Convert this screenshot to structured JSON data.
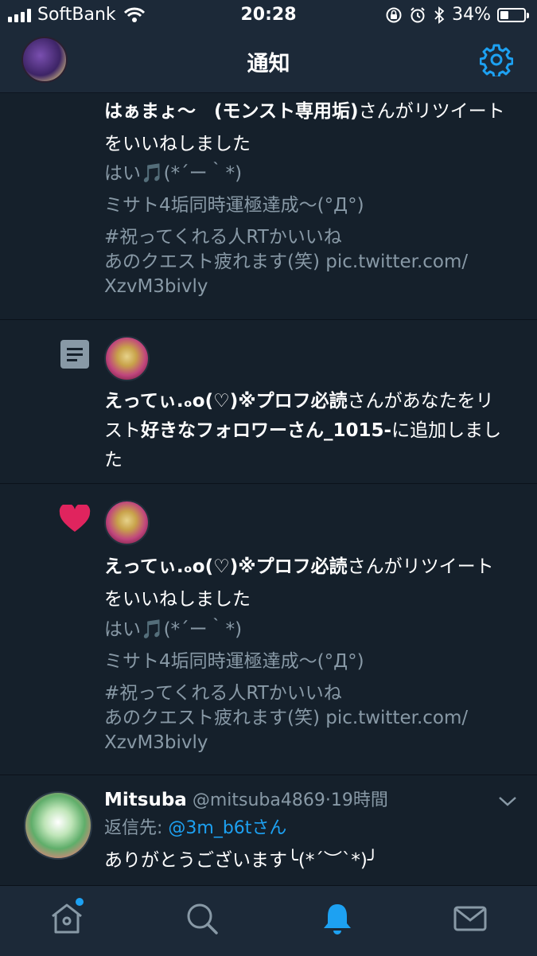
{
  "status_bar": {
    "carrier": "SoftBank",
    "time": "20:28",
    "battery": "34%",
    "battery_level": 0.34
  },
  "header": {
    "title": "通知"
  },
  "notifications": [
    {
      "type": "like",
      "user": "はぁまょ〜　(モンスト専用垢)",
      "action_line1": "さんがリツイート",
      "action_line2": "をいいねしました",
      "quote": [
        "はい🎵(*´ー｀*)",
        "ミサト4垢同時運極達成〜(°Д°)",
        "#祝ってくれる人RTかいいね",
        "あのクエスト疲れます(笑) pic.twitter.com/",
        "XzvM3bivly"
      ]
    },
    {
      "type": "list",
      "icon": "list-icon",
      "user": "えってぃ.ₒo(♡)※プロフ必読",
      "action_a": "さんがあなたをリ",
      "action_b": "スト",
      "list_name": "好きなフォロワーさん_1015-",
      "action_c": "に追加しまし",
      "action_d": "た"
    },
    {
      "type": "like",
      "icon": "heart-icon",
      "color": "#e0245e",
      "user": "えってぃ.ₒo(♡)※プロフ必読",
      "action_line1": "さんがリツイート",
      "action_line2": "をいいねしました",
      "quote": [
        "はい🎵(*´ー｀*)",
        "ミサト4垢同時運極達成〜(°Д°)",
        "#祝ってくれる人RTかいいね",
        "あのクエスト疲れます(笑) pic.twitter.com/",
        "XzvM3bivly"
      ]
    }
  ],
  "tweet": {
    "name": "Mitsuba",
    "handle": "@mitsuba4869",
    "separator": "·",
    "time": "19時間",
    "reply_label": "返信先: ",
    "reply_to": "@3m_b6tさん",
    "body": "ありがとうございます╰(*´︶`*)╯"
  },
  "tabs": [
    "home-icon",
    "search-icon",
    "bell-icon",
    "mail-icon"
  ],
  "colors": {
    "accent": "#1da1f2",
    "background": "#15202b",
    "bar": "#1c2938",
    "heart": "#e0245e",
    "muted": "#8899a6"
  }
}
